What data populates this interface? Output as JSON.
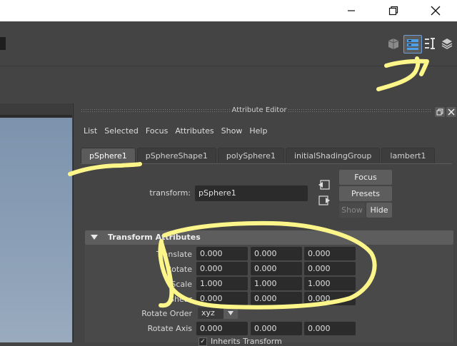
{
  "window": {
    "controls": [
      {
        "name": "minimize",
        "glyph": "—"
      },
      {
        "name": "maximize",
        "glyph": "❐"
      },
      {
        "name": "close",
        "glyph": "✕"
      }
    ]
  },
  "toolbar_icons": [
    "hypershade-icon",
    "attribute-editor-toggle-icon",
    "tool-settings-icon",
    "channel-box-icon"
  ],
  "attribute_editor": {
    "title": "Attribute Editor",
    "menu": [
      "List",
      "Selected",
      "Focus",
      "Attributes",
      "Show",
      "Help"
    ],
    "tabs": [
      {
        "label": "pSphere1",
        "active": true
      },
      {
        "label": "pSphereShape1",
        "active": false
      },
      {
        "label": "polySphere1",
        "active": false
      },
      {
        "label": "initialShadingGroup",
        "active": false
      },
      {
        "label": "lambert1",
        "active": false
      }
    ],
    "transform_label": "transform:",
    "transform_value": "pSphere1",
    "buttons": {
      "focus": "Focus",
      "presets": "Presets",
      "show": "Show",
      "hide": "Hide"
    },
    "section_title": "Transform Attributes",
    "rows": [
      {
        "label": "Translate",
        "values": [
          "0.000",
          "0.000",
          "0.000"
        ]
      },
      {
        "label": "Rotate",
        "values": [
          "0.000",
          "0.000",
          "0.000"
        ]
      },
      {
        "label": "Scale",
        "values": [
          "1.000",
          "1.000",
          "1.000"
        ]
      },
      {
        "label": "Shear",
        "values": [
          "0.000",
          "0.000",
          "0.000"
        ]
      }
    ],
    "rotate_order_label": "Rotate Order",
    "rotate_order_value": "xyz",
    "rotate_axis_label": "Rotate Axis",
    "rotate_axis_values": [
      "0.000",
      "0.000",
      "0.000"
    ],
    "inherits_transform_label": "Inherits Transform"
  },
  "colors": {
    "panel": "#444444",
    "field": "#2b2b2b",
    "annotation": "#fbf58a"
  }
}
